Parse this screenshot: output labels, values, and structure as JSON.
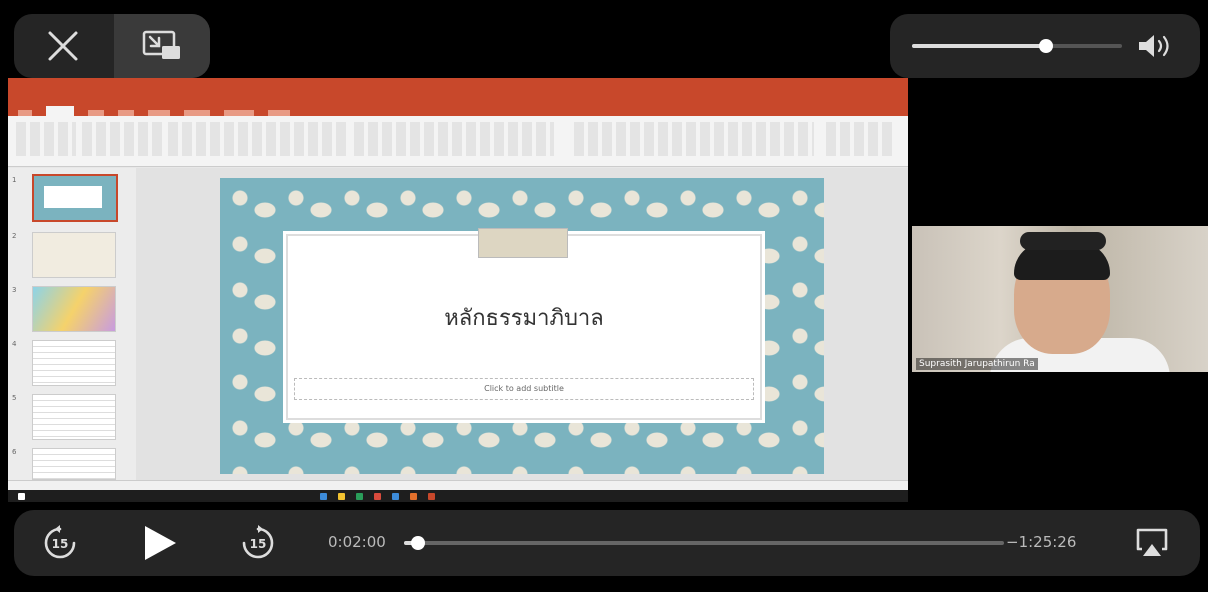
{
  "player": {
    "elapsed": "0:02:00",
    "remaining": "−1:25:26",
    "progress_fraction": 0.0225,
    "volume_fraction": 0.64,
    "skip_seconds": "15"
  },
  "presentation": {
    "slide_title": "หลักธรรมาภิบาล",
    "slide_subtitle_placeholder": "Click to add subtitle",
    "slide_numbers": [
      "1",
      "2",
      "3",
      "4",
      "5",
      "6"
    ]
  },
  "participant": {
    "name": "Suprasith Jarupathirun Ra"
  },
  "colors": {
    "ppt_accent": "#c8482b",
    "slide_pattern": "#7bb3bf",
    "control_pill": "#282828"
  }
}
